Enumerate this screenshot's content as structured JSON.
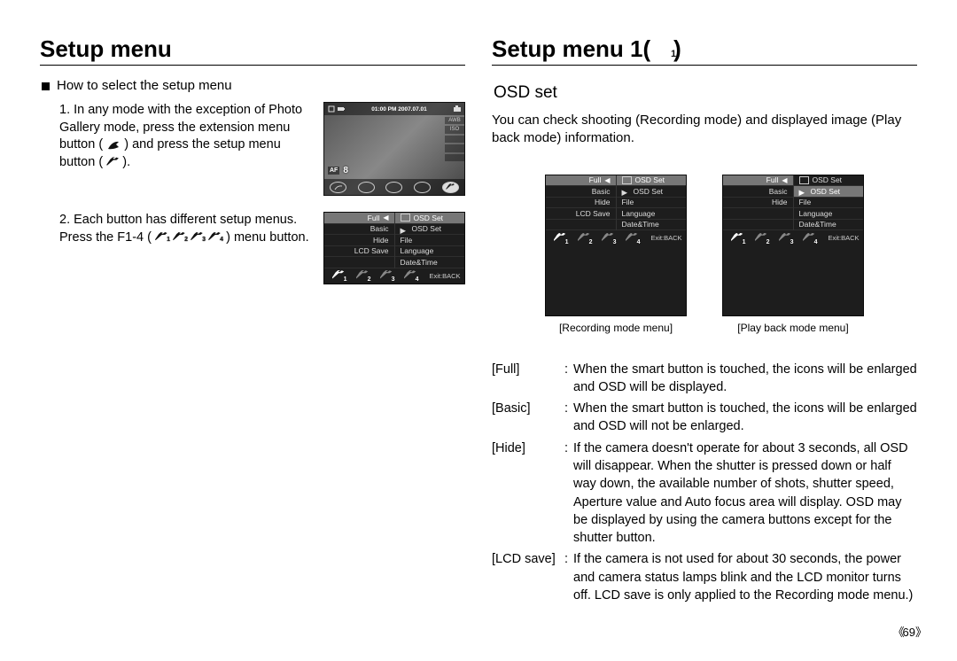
{
  "left": {
    "title": "Setup menu",
    "section_heading": "How to select the setup menu",
    "item1": {
      "num": "1.",
      "text_a": "In any mode with the exception of Photo Gallery mode, press the extension menu button (",
      "text_b": ") and press the setup menu button (",
      "text_c": ")."
    },
    "item2": {
      "num": "2.",
      "text_a": "Each button has different setup menus. Press the F1-4 (",
      "text_b": ") menu button."
    },
    "photo_screen": {
      "top_time": "01:00 PM 2007.07.01",
      "right_labels": [
        "AWB",
        "ISO",
        "",
        "",
        "",
        ""
      ],
      "af": "AF",
      "number": "8"
    },
    "menu_screen": {
      "left_rows": [
        "Full",
        "Basic",
        "Hide",
        "LCD Save",
        ""
      ],
      "left_highlight_index": 0,
      "right_rows": [
        {
          "icon": "camera",
          "label": "OSD Set"
        },
        {
          "icon": "play",
          "label": "OSD Set"
        },
        {
          "icon": "",
          "label": "File"
        },
        {
          "icon": "",
          "label": "Language"
        },
        {
          "icon": "",
          "label": "Date&Time"
        }
      ],
      "right_highlight_index": 0,
      "footer_nums": [
        "1",
        "2",
        "3",
        "4"
      ],
      "footer_exit": "Exit:BACK"
    }
  },
  "right": {
    "title_prefix": "Setup menu 1(",
    "title_suffix": ")",
    "subtitle": "OSD set",
    "intro": "You can check shooting (Recording mode) and displayed image (Play back mode) information.",
    "fig1_caption": "[Recording mode menu]",
    "fig2_caption": "[Play back mode menu]",
    "menu1": {
      "left_rows": [
        "Full",
        "Basic",
        "Hide",
        "LCD Save",
        ""
      ],
      "left_highlight_index": 0,
      "right_rows": [
        {
          "icon": "camera",
          "label": "OSD Set"
        },
        {
          "icon": "play",
          "label": "OSD Set"
        },
        {
          "icon": "",
          "label": "File"
        },
        {
          "icon": "",
          "label": "Language"
        },
        {
          "icon": "",
          "label": "Date&Time"
        }
      ],
      "right_highlight_index": 0,
      "footer_nums": [
        "1",
        "2",
        "3",
        "4"
      ],
      "footer_exit": "Exit:BACK"
    },
    "menu2": {
      "left_rows": [
        "Full",
        "Basic",
        "Hide",
        "",
        ""
      ],
      "left_highlight_index": 0,
      "right_rows": [
        {
          "icon": "camera",
          "label": "OSD Set"
        },
        {
          "icon": "play",
          "label": "OSD Set"
        },
        {
          "icon": "",
          "label": "File"
        },
        {
          "icon": "",
          "label": "Language"
        },
        {
          "icon": "",
          "label": "Date&Time"
        }
      ],
      "right_highlight_index": 1,
      "footer_nums": [
        "1",
        "2",
        "3",
        "4"
      ],
      "footer_exit": "Exit:BACK"
    },
    "defs": [
      {
        "term": "[Full]",
        "desc": "When the smart button is touched, the icons will be enlarged and OSD will be displayed."
      },
      {
        "term": "[Basic]",
        "desc": "When the smart button is touched, the icons will be enlarged and OSD will not be enlarged."
      },
      {
        "term": "[Hide]",
        "desc": "If the camera doesn't operate for about 3 seconds, all OSD will disappear. When the shutter is pressed down or half way down, the available number of shots, shutter speed, Aperture value and Auto focus area will display. OSD may be displayed by using the camera buttons except for the shutter button."
      },
      {
        "term": "[LCD save]",
        "desc": "If the camera is not used for about 30 seconds, the power and camera status lamps blink and the LCD monitor turns off. LCD save is only applied to the Recording mode menu.)"
      }
    ]
  },
  "page_number": "69"
}
